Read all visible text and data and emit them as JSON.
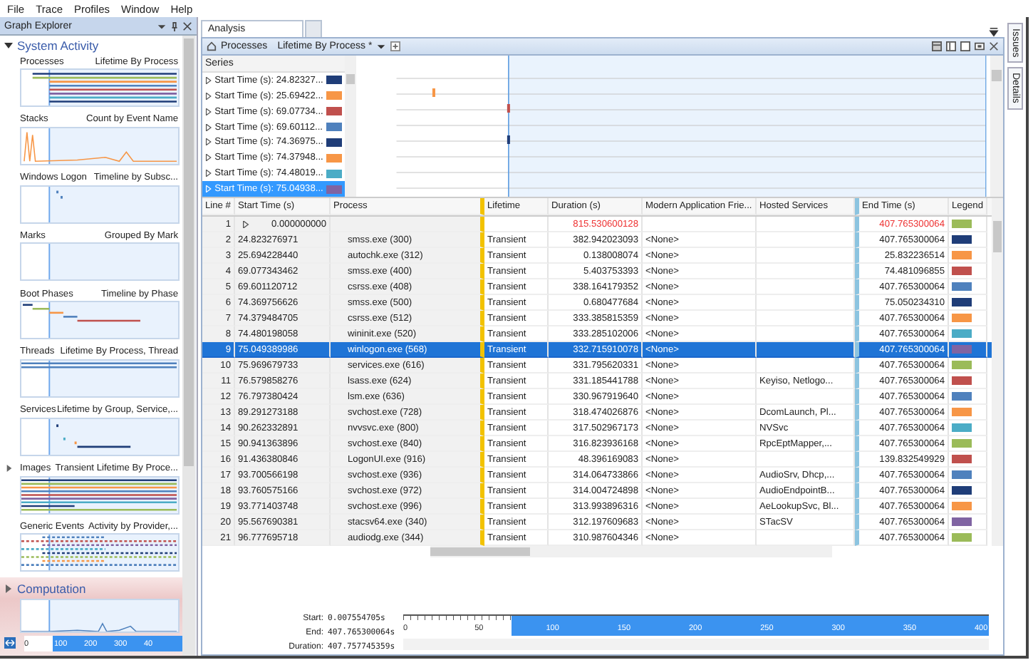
{
  "menu": [
    "File",
    "Trace",
    "Profiles",
    "Window",
    "Help"
  ],
  "graph_explorer": {
    "title": "Graph Explorer",
    "groups": [
      {
        "name": "System Activity",
        "expanded": true,
        "selected": false,
        "graphs": [
          {
            "name": "Processes",
            "view": "Lifetime By Process",
            "expandable": false
          },
          {
            "name": "Stacks",
            "view": "Count by Event Name",
            "expandable": false
          },
          {
            "name": "Windows Logon",
            "view": "Timeline by Subsc...",
            "expandable": false
          },
          {
            "name": "Marks",
            "view": "Grouped By Mark",
            "expandable": false
          },
          {
            "name": "Boot Phases",
            "view": "Timeline by Phase",
            "expandable": false
          },
          {
            "name": "Threads",
            "view": "Lifetime By Process, Thread",
            "expandable": false
          },
          {
            "name": "Services",
            "view": "Lifetime by Group, Service,...",
            "expandable": false
          },
          {
            "name": "Images",
            "view": "Transient Lifetime By Proce...",
            "expandable": true
          },
          {
            "name": "Generic Events",
            "view": "Activity by Provider,...",
            "expandable": false
          }
        ]
      },
      {
        "name": "Computation",
        "expanded": false,
        "selected": true,
        "axis": [
          "0",
          "100",
          "200",
          "300",
          "40"
        ]
      }
    ]
  },
  "tabs": [
    {
      "label": "Analysis",
      "selected": true
    }
  ],
  "panel": {
    "graph": "Processes",
    "view": "Lifetime By Process *"
  },
  "series": {
    "header": "Series",
    "items": [
      {
        "label": "Start Time (s): 24.82327...",
        "color": "#1f3d78",
        "selected": false
      },
      {
        "label": "Start Time (s): 25.69422...",
        "color": "#f79646",
        "selected": false
      },
      {
        "label": "Start Time (s): 69.07734...",
        "color": "#c0504d",
        "selected": false
      },
      {
        "label": "Start Time (s): 69.60112...",
        "color": "#4f81bd",
        "selected": false
      },
      {
        "label": "Start Time (s): 74.36975...",
        "color": "#1f3d78",
        "selected": false
      },
      {
        "label": "Start Time (s): 74.37948...",
        "color": "#f79646",
        "selected": false
      },
      {
        "label": "Start Time (s): 74.48019...",
        "color": "#4bacc6",
        "selected": false
      },
      {
        "label": "Start Time (s): 75.04938...",
        "color": "#8064a2",
        "selected": true
      }
    ]
  },
  "table": {
    "columns": [
      "Line #",
      "Start Time (s)",
      "Process",
      "Lifetime",
      "Duration (s)",
      "Modern Application Frie...",
      "Hosted Services",
      "End Time (s)",
      "Legend"
    ],
    "rows": [
      {
        "kind": "total",
        "line": "1",
        "start": "0.000000000",
        "process": "",
        "lifetime": "",
        "duration": "815.530600128",
        "modern_app": "",
        "hosted": "",
        "end": "407.765300064",
        "color": "#9bbb59",
        "selected": false
      },
      {
        "kind": "process",
        "line": "2",
        "start": "24.823276971",
        "process": "smss.exe (300)",
        "lifetime": "Transient",
        "duration": "382.942023093",
        "modern_app": "<None>",
        "hosted": "",
        "end": "407.765300064",
        "color": "#1f3d78",
        "selected": false
      },
      {
        "kind": "process",
        "line": "3",
        "start": "25.694228440",
        "process": "autochk.exe (312)",
        "lifetime": "Transient",
        "duration": "0.138008074",
        "modern_app": "<None>",
        "hosted": "",
        "end": "25.832236514",
        "color": "#f79646",
        "selected": false
      },
      {
        "kind": "process",
        "line": "4",
        "start": "69.077343462",
        "process": "smss.exe (400)",
        "lifetime": "Transient",
        "duration": "5.403753393",
        "modern_app": "<None>",
        "hosted": "",
        "end": "74.481096855",
        "color": "#c0504d",
        "selected": false
      },
      {
        "kind": "process",
        "line": "5",
        "start": "69.601120712",
        "process": "csrss.exe (408)",
        "lifetime": "Transient",
        "duration": "338.164179352",
        "modern_app": "<None>",
        "hosted": "",
        "end": "407.765300064",
        "color": "#4f81bd",
        "selected": false
      },
      {
        "kind": "process",
        "line": "6",
        "start": "74.369756626",
        "process": "smss.exe (500)",
        "lifetime": "Transient",
        "duration": "0.680477684",
        "modern_app": "<None>",
        "hosted": "",
        "end": "75.050234310",
        "color": "#1f3d78",
        "selected": false
      },
      {
        "kind": "process",
        "line": "7",
        "start": "74.379484705",
        "process": "csrss.exe (512)",
        "lifetime": "Transient",
        "duration": "333.385815359",
        "modern_app": "<None>",
        "hosted": "",
        "end": "407.765300064",
        "color": "#f79646",
        "selected": false
      },
      {
        "kind": "process",
        "line": "8",
        "start": "74.480198058",
        "process": "wininit.exe (520)",
        "lifetime": "Transient",
        "duration": "333.285102006",
        "modern_app": "<None>",
        "hosted": "",
        "end": "407.765300064",
        "color": "#4bacc6",
        "selected": false
      },
      {
        "kind": "process",
        "line": "9",
        "start": "75.049389986",
        "process": "winlogon.exe (568)",
        "lifetime": "Transient",
        "duration": "332.715910078",
        "modern_app": "<None>",
        "hosted": "",
        "end": "407.765300064",
        "color": "#8064a2",
        "selected": true
      },
      {
        "kind": "process",
        "line": "10",
        "start": "75.969679733",
        "process": "services.exe (616)",
        "lifetime": "Transient",
        "duration": "331.795620331",
        "modern_app": "<None>",
        "hosted": "",
        "end": "407.765300064",
        "color": "#9bbb59",
        "selected": false
      },
      {
        "kind": "process",
        "line": "11",
        "start": "76.579858276",
        "process": "lsass.exe (624)",
        "lifetime": "Transient",
        "duration": "331.185441788",
        "modern_app": "<None>",
        "hosted": "Keyiso, Netlogo...",
        "end": "407.765300064",
        "color": "#c0504d",
        "selected": false
      },
      {
        "kind": "process",
        "line": "12",
        "start": "76.797380424",
        "process": "lsm.exe (636)",
        "lifetime": "Transient",
        "duration": "330.967919640",
        "modern_app": "<None>",
        "hosted": "",
        "end": "407.765300064",
        "color": "#4f81bd",
        "selected": false
      },
      {
        "kind": "process",
        "line": "13",
        "start": "89.291273188",
        "process": "svchost.exe (728)",
        "lifetime": "Transient",
        "duration": "318.474026876",
        "modern_app": "<None>",
        "hosted": "DcomLaunch, Pl...",
        "end": "407.765300064",
        "color": "#f79646",
        "selected": false
      },
      {
        "kind": "process",
        "line": "14",
        "start": "90.262332891",
        "process": "nvvsvc.exe (800)",
        "lifetime": "Transient",
        "duration": "317.502967173",
        "modern_app": "<None>",
        "hosted": "NVSvc",
        "end": "407.765300064",
        "color": "#4bacc6",
        "selected": false
      },
      {
        "kind": "process",
        "line": "15",
        "start": "90.941363896",
        "process": "svchost.exe (840)",
        "lifetime": "Transient",
        "duration": "316.823936168",
        "modern_app": "<None>",
        "hosted": "RpcEptMapper,...",
        "end": "407.765300064",
        "color": "#9bbb59",
        "selected": false
      },
      {
        "kind": "process",
        "line": "16",
        "start": "91.436380846",
        "process": "LogonUI.exe (916)",
        "lifetime": "Transient",
        "duration": "48.396169083",
        "modern_app": "<None>",
        "hosted": "",
        "end": "139.832549929",
        "color": "#c0504d",
        "selected": false
      },
      {
        "kind": "process",
        "line": "17",
        "start": "93.700566198",
        "process": "svchost.exe (936)",
        "lifetime": "Transient",
        "duration": "314.064733866",
        "modern_app": "<None>",
        "hosted": "AudioSrv, Dhcp,...",
        "end": "407.765300064",
        "color": "#4f81bd",
        "selected": false
      },
      {
        "kind": "process",
        "line": "18",
        "start": "93.760575166",
        "process": "svchost.exe (972)",
        "lifetime": "Transient",
        "duration": "314.004724898",
        "modern_app": "<None>",
        "hosted": "AudioEndpointB...",
        "end": "407.765300064",
        "color": "#1f3d78",
        "selected": false
      },
      {
        "kind": "process",
        "line": "19",
        "start": "93.771403748",
        "process": "svchost.exe (996)",
        "lifetime": "Transient",
        "duration": "313.993896316",
        "modern_app": "<None>",
        "hosted": "AeLookupSvc, Bl...",
        "end": "407.765300064",
        "color": "#f79646",
        "selected": false
      },
      {
        "kind": "process",
        "line": "20",
        "start": "95.567690381",
        "process": "stacsv64.exe (340)",
        "lifetime": "Transient",
        "duration": "312.197609683",
        "modern_app": "<None>",
        "hosted": "STacSV",
        "end": "407.765300064",
        "color": "#8064a2",
        "selected": false
      },
      {
        "kind": "process",
        "line": "21",
        "start": "96.777695718",
        "process": "audiodg.exe (344)",
        "lifetime": "Transient",
        "duration": "310.987604346",
        "modern_app": "<None>",
        "hosted": "",
        "end": "407.765300064",
        "color": "#9bbb59",
        "selected": false
      }
    ]
  },
  "side_tabs": [
    "Issues",
    "Details"
  ],
  "time_range": {
    "start_label": "Start:",
    "start": "0.007554705s",
    "end_label": "End:",
    "end": "407.765300064s",
    "duration_label": "Duration:",
    "duration": "407.757745359s",
    "ruler": [
      "0",
      "50",
      "100",
      "150",
      "200",
      "250",
      "300",
      "350",
      "400"
    ],
    "selection": {
      "level": 0.816
    }
  }
}
